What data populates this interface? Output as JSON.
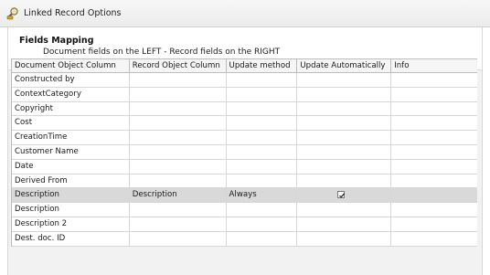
{
  "window": {
    "title": "Linked Record Options",
    "icon": "magnifier-link-icon"
  },
  "section": {
    "title": "Fields Mapping",
    "subtitle": "Document fields on the LEFT - Record fields on the RIGHT"
  },
  "grid": {
    "columns": [
      "Document Object Column",
      "Record Object Column",
      "Update method",
      "Update Automatically",
      "Info"
    ],
    "rows": [
      {
        "doc": "Constructed by",
        "rec": "",
        "method": "",
        "auto": false,
        "info": "",
        "selected": false
      },
      {
        "doc": "ContextCategory",
        "rec": "",
        "method": "",
        "auto": false,
        "info": "",
        "selected": false
      },
      {
        "doc": "Copyright",
        "rec": "",
        "method": "",
        "auto": false,
        "info": "",
        "selected": false
      },
      {
        "doc": "Cost",
        "rec": "",
        "method": "",
        "auto": false,
        "info": "",
        "selected": false
      },
      {
        "doc": "CreationTime",
        "rec": "",
        "method": "",
        "auto": false,
        "info": "",
        "selected": false
      },
      {
        "doc": "Customer Name",
        "rec": "",
        "method": "",
        "auto": false,
        "info": "",
        "selected": false
      },
      {
        "doc": "Date",
        "rec": "",
        "method": "",
        "auto": false,
        "info": "",
        "selected": false
      },
      {
        "doc": "Derived From",
        "rec": "",
        "method": "",
        "auto": false,
        "info": "",
        "selected": false
      },
      {
        "doc": "Description",
        "rec": "Description",
        "method": "Always",
        "auto": true,
        "info": "",
        "selected": true
      },
      {
        "doc": "Description",
        "rec": "",
        "method": "",
        "auto": false,
        "info": "",
        "selected": false
      },
      {
        "doc": "Description 2",
        "rec": "",
        "method": "",
        "auto": false,
        "info": "",
        "selected": false
      },
      {
        "doc": "Dest. doc. ID",
        "rec": "",
        "method": "",
        "auto": false,
        "info": "",
        "selected": false
      }
    ]
  },
  "colors": {
    "selected_row": "#d9d9d9",
    "grid_band": "#f2f2f2"
  }
}
